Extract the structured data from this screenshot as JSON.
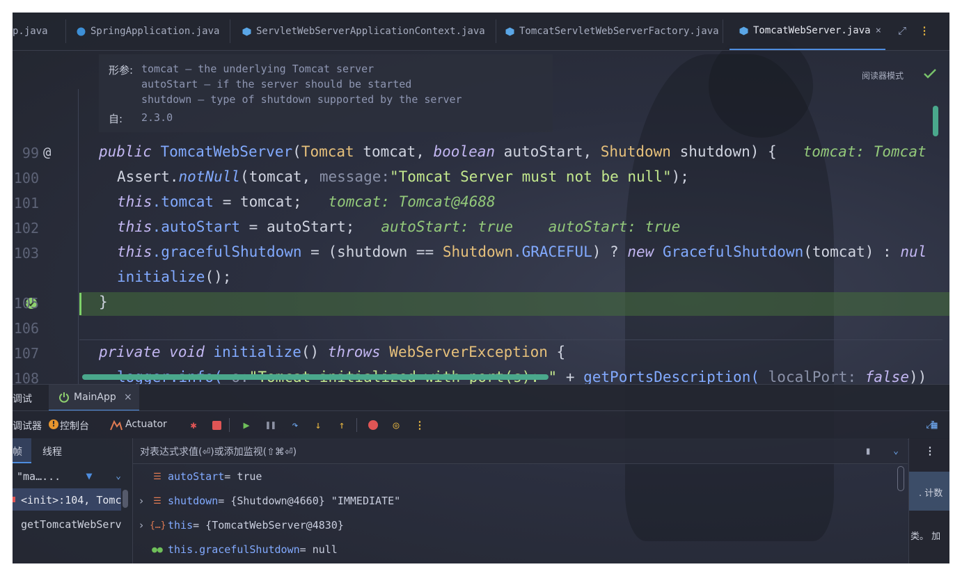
{
  "tabs": [
    {
      "label": "p.java",
      "active": false
    },
    {
      "label": "SpringApplication.java",
      "active": false
    },
    {
      "label": "ServletWebServerApplicationContext.java",
      "active": false
    },
    {
      "label": "TomcatServletWebServerFactory.java",
      "active": false
    },
    {
      "label": "TomcatWebServer.java",
      "active": true
    }
  ],
  "tab_close": "×",
  "toolbar": {
    "reader_mode": "阅读器模式"
  },
  "doc": {
    "params_label": "形参:",
    "param1": "tomcat – the underlying Tomcat server",
    "param2": "autoStart – if the server should be started",
    "param3": "shutdown – type of shutdown supported by the server",
    "since_label": "自:",
    "since_value": "2.3.0"
  },
  "lines": {
    "n99": "99",
    "n100": "100",
    "n101": "101",
    "n102": "102",
    "n103": "103",
    "n105": "105",
    "n106": "106",
    "n107": "107",
    "n108": "108"
  },
  "code": {
    "l99": {
      "kw": "public",
      "name": "TomcatWebServer",
      "p1t": "Tomcat",
      "p1": "tomcat",
      "p2t": "boolean",
      "p2": "autoStart",
      "p3t": "Shutdown",
      "p3": "shutdown",
      "end": ") {",
      "hint": "tomcat: Tomcat"
    },
    "l100": {
      "cls": "Assert",
      "fn": "notNull",
      "arg": "tomcat,",
      "hint": "message:",
      "str": "\"Tomcat Server must not be null\"",
      "end": ");"
    },
    "l101": {
      "this": "this",
      "field": ".tomcat",
      "rest": " = tomcat;",
      "hint": "tomcat: Tomcat@4688"
    },
    "l102": {
      "this": "this",
      "field": ".autoStart",
      "rest": " = autoStart;",
      "hint1": "autoStart: true",
      "hint2": "autoStart: true"
    },
    "l103": {
      "this": "this",
      "field": ".gracefulShutdown",
      "rest1": " = (shutdown == ",
      "ty": "Shutdown",
      "const": ".GRACEFUL",
      "rest2": ") ? ",
      "new": "new",
      "cls": "GracefulShutdown",
      "rest3": "(tomcat) : ",
      "nul": "nul"
    },
    "l104": {
      "call": "initialize",
      "rest": "();"
    },
    "l105": {
      "brace": "}"
    },
    "l107": {
      "kw1": "private",
      "kw2": "void",
      "fn": "initialize",
      "rest": "() ",
      "kw3": "throws",
      "ty": "WebServerException",
      "end": " {"
    },
    "l108": {
      "obj": "logger",
      "fn": ".info(",
      "hint": "o:",
      "str": "\"Tomcat initialized with port(s): \"",
      "rest": " + ",
      "call": "getPortsDescription(",
      "hint2": "localPort:",
      "kw": "false",
      "end": "))"
    }
  },
  "debug": {
    "title": "调试",
    "session": "MainApp",
    "session_close": "×",
    "tool_debugger": "调试器",
    "tool_console": "控制台",
    "tool_actuator": "Actuator",
    "frames_tab": "帧",
    "threads_tab": "线程",
    "thread_filter": "\"ma…...",
    "frame1": "<init>:104, Tomc",
    "frame2": "getTomcatWebServ",
    "eval_placeholder": "对表达式求值(⏎)或添加监视(⇧⌘⏎)",
    "vars": [
      {
        "name": "autoStart",
        "value": " = true"
      },
      {
        "name": "shutdown",
        "value": " = {Shutdown@4660} \"IMMEDIATE\""
      },
      {
        "name": "this",
        "value": " = {TomcatWebServer@4830}"
      },
      {
        "name": "this.gracefulShutdown",
        "value": " = null"
      }
    ],
    "side_text1": ". 计数",
    "side_text2": "类。 加"
  },
  "colors": {
    "accent": "#4e8ddf",
    "current_line": "#466e3c",
    "scrollbar": "#4aa88c"
  }
}
